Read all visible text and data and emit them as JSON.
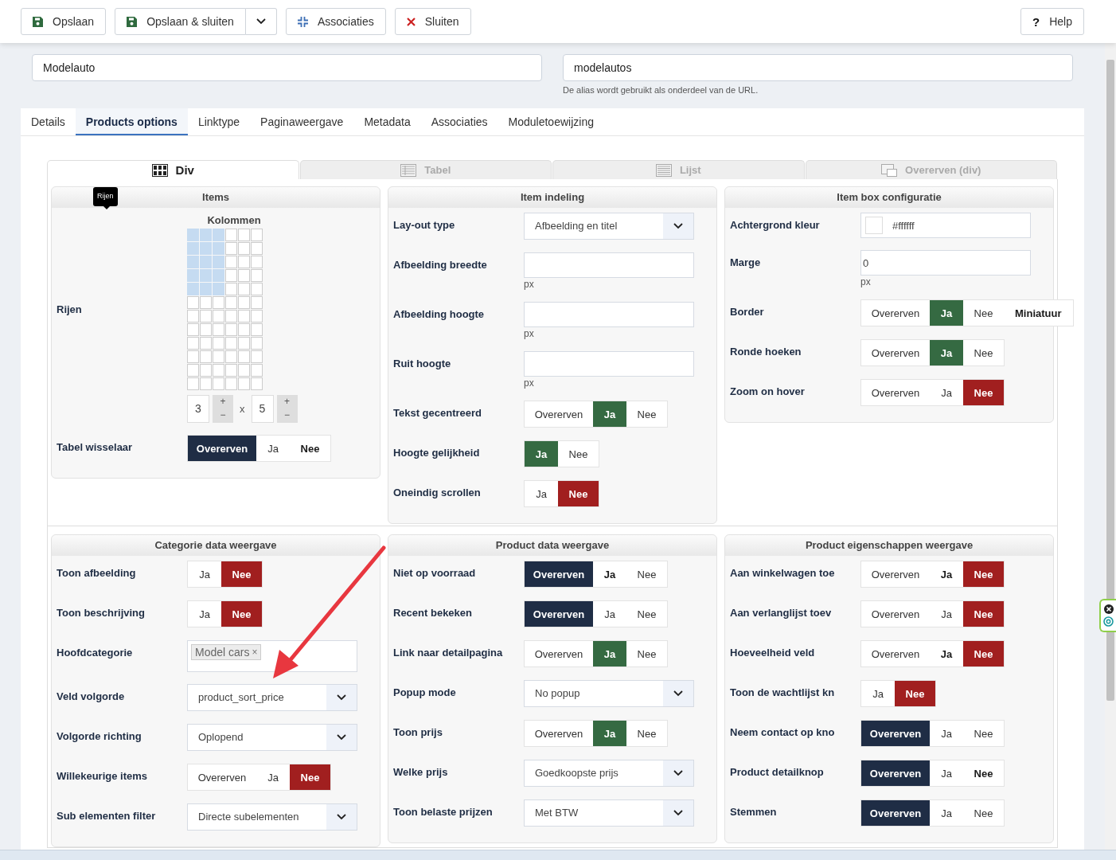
{
  "toolbar": {
    "buttons": [
      {
        "label": "Opslaan",
        "kind": "save"
      },
      {
        "label": "Opslaan & sluiten",
        "kind": "save",
        "dropdown": true
      },
      {
        "label": "Associaties",
        "kind": "associations"
      },
      {
        "label": "Sluiten",
        "kind": "close"
      }
    ],
    "help": {
      "label": "Help",
      "glyph": "?"
    }
  },
  "title_field": {
    "value": "Modelauto"
  },
  "alias_field": {
    "value": "modelautos",
    "hint": "De alias wordt gebruikt als onderdeel van de URL."
  },
  "tabs": [
    {
      "label": "Details",
      "selected": false
    },
    {
      "label": "Products options",
      "selected": true
    },
    {
      "label": "Linktype",
      "selected": false
    },
    {
      "label": "Paginaweergave",
      "selected": false
    },
    {
      "label": "Metadata",
      "selected": false
    },
    {
      "label": "Associaties",
      "selected": false
    },
    {
      "label": "Moduletoewijzing",
      "selected": false
    }
  ],
  "layout_tabs": [
    {
      "label": "Div",
      "kind": "grid",
      "selected": true
    },
    {
      "label": "Tabel",
      "kind": "table",
      "selected": false
    },
    {
      "label": "Lijst",
      "kind": "list",
      "selected": false
    },
    {
      "label": "Overerven (div)",
      "kind": "inherit",
      "selected": false
    }
  ],
  "top_panels": [
    {
      "title": "Items",
      "kind": "grid",
      "tooltip": "Rijen",
      "columns_label": "Kolommen",
      "rows_label": "Rijen",
      "grid_rows": [
        [
          true,
          true,
          true,
          false,
          false,
          false
        ],
        [
          true,
          true,
          true,
          false,
          false,
          false
        ],
        [
          true,
          true,
          true,
          false,
          false,
          false
        ],
        [
          true,
          true,
          true,
          false,
          false,
          false
        ],
        [
          true,
          true,
          true,
          false,
          false,
          false
        ],
        [
          false,
          false,
          false,
          false,
          false,
          false
        ],
        [
          false,
          false,
          false,
          false,
          false,
          false
        ],
        [
          false,
          false,
          false,
          false,
          false,
          false
        ],
        [
          false,
          false,
          false,
          false,
          false,
          false
        ],
        [
          false,
          false,
          false,
          false,
          false,
          false
        ],
        [
          false,
          false,
          false,
          false,
          false,
          false
        ],
        [
          false,
          false,
          false,
          false,
          false,
          false
        ]
      ],
      "spinners": [
        {
          "value": "3",
          "up": "+",
          "down": "−"
        },
        {
          "value": "5",
          "up": "+",
          "down": "−"
        }
      ],
      "times": "x",
      "rows": [
        {
          "label": "Tabel wisselaar",
          "kind": "toggle",
          "options": [
            {
              "label": "Overerven",
              "kind": "inherit",
              "selected": true,
              "emphasized": false
            },
            {
              "label": "Ja",
              "kind": "yes",
              "selected": false,
              "emphasized": false
            },
            {
              "label": "Nee",
              "kind": "no",
              "selected": false,
              "emphasized": true
            }
          ]
        }
      ]
    },
    {
      "title": "Item indeling",
      "rows": [
        {
          "label": "Lay-out type",
          "kind": "select",
          "value": "Afbeelding en titel"
        },
        {
          "label": "Afbeelding breedte",
          "kind": "text",
          "unit": "px"
        },
        {
          "label": "Afbeelding hoogte",
          "kind": "text",
          "unit": "px"
        },
        {
          "label": "Ruit hoogte",
          "kind": "text",
          "unit": "px"
        },
        {
          "label": "Tekst gecentreerd",
          "kind": "toggle",
          "options": [
            {
              "label": "Overerven",
              "kind": "inherit",
              "selected": false,
              "emphasized": false
            },
            {
              "label": "Ja",
              "kind": "yes",
              "selected": true,
              "emphasized": false
            },
            {
              "label": "Nee",
              "kind": "no",
              "selected": false,
              "emphasized": false
            }
          ]
        },
        {
          "label": "Hoogte gelijkheid",
          "kind": "toggle",
          "options": [
            {
              "label": "Ja",
              "kind": "yes",
              "selected": true,
              "emphasized": false
            },
            {
              "label": "Nee",
              "kind": "no",
              "selected": false,
              "emphasized": false
            }
          ]
        },
        {
          "label": "Oneindig scrollen",
          "kind": "toggle",
          "options": [
            {
              "label": "Ja",
              "kind": "yes",
              "selected": false,
              "emphasized": false
            },
            {
              "label": "Nee",
              "kind": "no",
              "selected": true,
              "emphasized": false
            }
          ]
        }
      ]
    },
    {
      "title": "Item box configuratie",
      "rows": [
        {
          "label": "Achtergrond kleur",
          "kind": "color",
          "value": "#ffffff"
        },
        {
          "label": "Marge",
          "kind": "text",
          "value": "0",
          "unit": "px"
        },
        {
          "label": "Border",
          "kind": "toggle",
          "options": [
            {
              "label": "Overerven",
              "kind": "inherit",
              "selected": false,
              "emphasized": false
            },
            {
              "label": "Ja",
              "kind": "yes",
              "selected": true,
              "emphasized": false
            },
            {
              "label": "Nee",
              "kind": "no",
              "selected": false,
              "emphasized": false
            },
            {
              "label": "Miniatuur",
              "kind": "other",
              "selected": false,
              "emphasized": true
            }
          ]
        },
        {
          "label": "Ronde hoeken",
          "kind": "toggle",
          "options": [
            {
              "label": "Overerven",
              "kind": "inherit",
              "selected": false,
              "emphasized": false
            },
            {
              "label": "Ja",
              "kind": "yes",
              "selected": true,
              "emphasized": false
            },
            {
              "label": "Nee",
              "kind": "no",
              "selected": false,
              "emphasized": false
            }
          ]
        },
        {
          "label": "Zoom on hover",
          "kind": "toggle",
          "options": [
            {
              "label": "Overerven",
              "kind": "inherit",
              "selected": false,
              "emphasized": false
            },
            {
              "label": "Ja",
              "kind": "yes",
              "selected": false,
              "emphasized": false
            },
            {
              "label": "Nee",
              "kind": "no",
              "selected": true,
              "emphasized": false
            }
          ]
        }
      ]
    }
  ],
  "bottom_panels": [
    {
      "title": "Categorie data weergave",
      "rows": [
        {
          "label": "Toon afbeelding",
          "kind": "toggle",
          "options": [
            {
              "label": "Ja",
              "kind": "yes",
              "selected": false,
              "emphasized": false
            },
            {
              "label": "Nee",
              "kind": "no",
              "selected": true,
              "emphasized": false
            }
          ]
        },
        {
          "label": "Toon beschrijving",
          "kind": "toggle",
          "options": [
            {
              "label": "Ja",
              "kind": "yes",
              "selected": false,
              "emphasized": false
            },
            {
              "label": "Nee",
              "kind": "no",
              "selected": true,
              "emphasized": false
            }
          ]
        },
        {
          "label": "Hoofdcategorie",
          "kind": "tags",
          "tags": [
            {
              "label": "Model cars",
              "remove": "×"
            }
          ]
        },
        {
          "label": "Veld volgorde",
          "kind": "select",
          "value": "product_sort_price"
        },
        {
          "label": "Volgorde richting",
          "kind": "select",
          "value": "Oplopend"
        },
        {
          "label": "Willekeurige items",
          "kind": "toggle",
          "options": [
            {
              "label": "Overerven",
              "kind": "inherit",
              "selected": false,
              "emphasized": false
            },
            {
              "label": "Ja",
              "kind": "yes",
              "selected": false,
              "emphasized": false
            },
            {
              "label": "Nee",
              "kind": "no",
              "selected": true,
              "emphasized": false
            }
          ]
        },
        {
          "label": "Sub elementen filter",
          "kind": "select",
          "value": "Directe subelementen"
        }
      ]
    },
    {
      "title": "Product data weergave",
      "rows": [
        {
          "label": "Niet op voorraad",
          "kind": "toggle",
          "options": [
            {
              "label": "Overerven",
              "kind": "inherit",
              "selected": true,
              "emphasized": false
            },
            {
              "label": "Ja",
              "kind": "yes",
              "selected": false,
              "emphasized": true
            },
            {
              "label": "Nee",
              "kind": "no",
              "selected": false,
              "emphasized": false
            }
          ]
        },
        {
          "label": "Recent bekeken",
          "kind": "toggle",
          "options": [
            {
              "label": "Overerven",
              "kind": "inherit",
              "selected": true,
              "emphasized": false
            },
            {
              "label": "Ja",
              "kind": "yes",
              "selected": false,
              "emphasized": false
            },
            {
              "label": "Nee",
              "kind": "no",
              "selected": false,
              "emphasized": false
            }
          ]
        },
        {
          "label": "Link naar detailpagina",
          "kind": "toggle",
          "options": [
            {
              "label": "Overerven",
              "kind": "inherit",
              "selected": false,
              "emphasized": false
            },
            {
              "label": "Ja",
              "kind": "yes",
              "selected": true,
              "emphasized": false
            },
            {
              "label": "Nee",
              "kind": "no",
              "selected": false,
              "emphasized": false
            }
          ]
        },
        {
          "label": "Popup mode",
          "kind": "select",
          "value": "No popup"
        },
        {
          "label": "Toon prijs",
          "kind": "toggle",
          "options": [
            {
              "label": "Overerven",
              "kind": "inherit",
              "selected": false,
              "emphasized": false
            },
            {
              "label": "Ja",
              "kind": "yes",
              "selected": true,
              "emphasized": false
            },
            {
              "label": "Nee",
              "kind": "no",
              "selected": false,
              "emphasized": false
            }
          ]
        },
        {
          "label": "Welke prijs",
          "kind": "select",
          "value": "Goedkoopste prijs"
        },
        {
          "label": "Toon belaste prijzen",
          "kind": "select",
          "value": "Met BTW"
        }
      ]
    },
    {
      "title": "Product eigenschappen weergave",
      "rows": [
        {
          "label": "Aan winkelwagen toe",
          "kind": "toggle",
          "options": [
            {
              "label": "Overerven",
              "kind": "inherit",
              "selected": false,
              "emphasized": false
            },
            {
              "label": "Ja",
              "kind": "yes",
              "selected": false,
              "emphasized": true
            },
            {
              "label": "Nee",
              "kind": "no",
              "selected": true,
              "emphasized": false
            }
          ]
        },
        {
          "label": "Aan verlanglijst toev",
          "kind": "toggle",
          "options": [
            {
              "label": "Overerven",
              "kind": "inherit",
              "selected": false,
              "emphasized": false
            },
            {
              "label": "Ja",
              "kind": "yes",
              "selected": false,
              "emphasized": false
            },
            {
              "label": "Nee",
              "kind": "no",
              "selected": true,
              "emphasized": false
            }
          ]
        },
        {
          "label": "Hoeveelheid veld",
          "kind": "toggle",
          "options": [
            {
              "label": "Overerven",
              "kind": "inherit",
              "selected": false,
              "emphasized": false
            },
            {
              "label": "Ja",
              "kind": "yes",
              "selected": false,
              "emphasized": true
            },
            {
              "label": "Nee",
              "kind": "no",
              "selected": true,
              "emphasized": false
            }
          ]
        },
        {
          "label": "Toon de wachtlijst kn",
          "kind": "toggle",
          "options": [
            {
              "label": "Ja",
              "kind": "yes",
              "selected": false,
              "emphasized": false
            },
            {
              "label": "Nee",
              "kind": "no",
              "selected": true,
              "emphasized": false
            }
          ]
        },
        {
          "label": "Neem contact op kno",
          "kind": "toggle",
          "options": [
            {
              "label": "Overerven",
              "kind": "inherit",
              "selected": true,
              "emphasized": false
            },
            {
              "label": "Ja",
              "kind": "yes",
              "selected": false,
              "emphasized": false
            },
            {
              "label": "Nee",
              "kind": "no",
              "selected": false,
              "emphasized": false
            }
          ]
        },
        {
          "label": "Product detailknop",
          "kind": "toggle",
          "options": [
            {
              "label": "Overerven",
              "kind": "inherit",
              "selected": true,
              "emphasized": false
            },
            {
              "label": "Ja",
              "kind": "yes",
              "selected": false,
              "emphasized": false
            },
            {
              "label": "Nee",
              "kind": "no",
              "selected": false,
              "emphasized": true
            }
          ]
        },
        {
          "label": "Stemmen",
          "kind": "toggle",
          "options": [
            {
              "label": "Overerven",
              "kind": "inherit",
              "selected": true,
              "emphasized": false
            },
            {
              "label": "Ja",
              "kind": "yes",
              "selected": false,
              "emphasized": false
            },
            {
              "label": "Nee",
              "kind": "no",
              "selected": false,
              "emphasized": false
            }
          ]
        }
      ]
    }
  ]
}
